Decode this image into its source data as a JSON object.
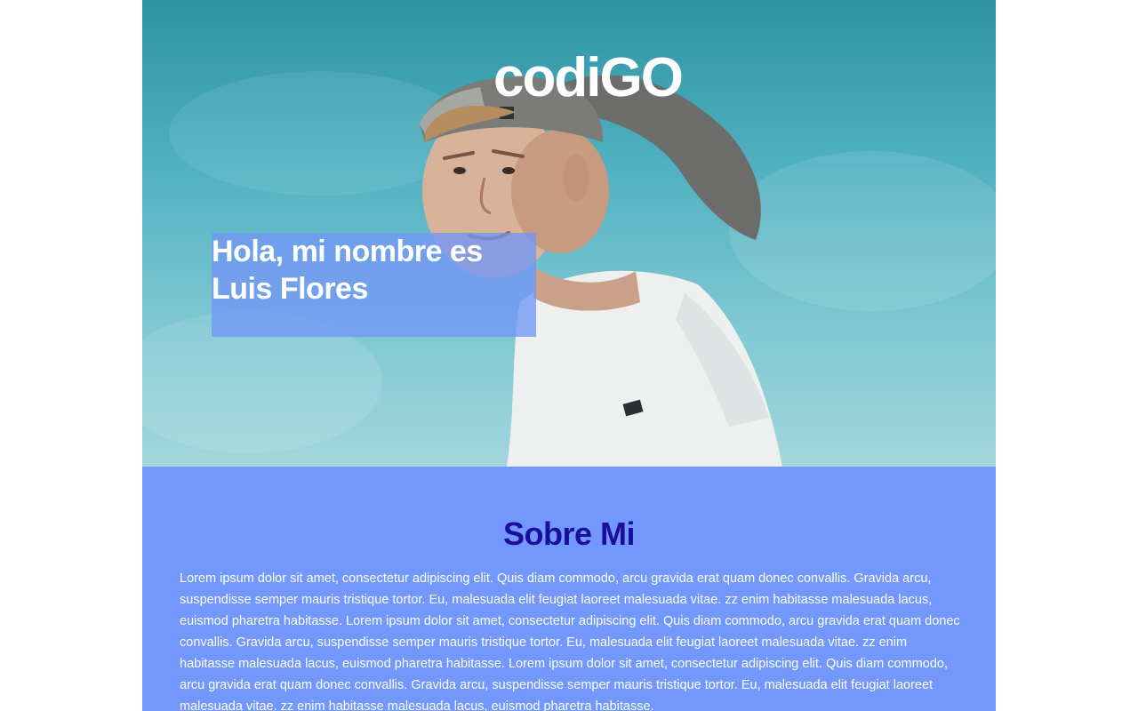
{
  "hero": {
    "logo": "codiGO",
    "greeting": "Hola, mi nombre es Luis Flores"
  },
  "about": {
    "title": "Sobre Mi",
    "body": "Lorem ipsum dolor sit amet, consectetur adipiscing elit. Quis diam commodo, arcu gravida erat quam donec convallis. Gravida arcu, suspendisse semper mauris tristique tortor. Eu, malesuada elit feugiat laoreet malesuada vitae. zz enim habitasse malesuada lacus, euismod pharetra habitasse. Lorem ipsum dolor sit amet, consectetur adipiscing elit. Quis diam commodo, arcu gravida erat quam donec convallis. Gravida arcu, suspendisse semper mauris tristique tortor. Eu, malesuada elit feugiat laoreet malesuada vitae. zz enim habitasse malesuada lacus, euismod pharetra habitasse. Lorem ipsum dolor sit amet, consectetur adipiscing elit. Quis diam commodo, arcu gravida erat quam donec convallis. Gravida arcu, suspendisse semper mauris tristique tortor. Eu, malesuada elit feugiat laoreet malesuada vitae. zz enim habitasse malesuada lacus, euismod pharetra habitasse."
  },
  "colors": {
    "accent": "#7298fe",
    "heading": "#1a0f9c",
    "sky": "#4fb0c0"
  }
}
